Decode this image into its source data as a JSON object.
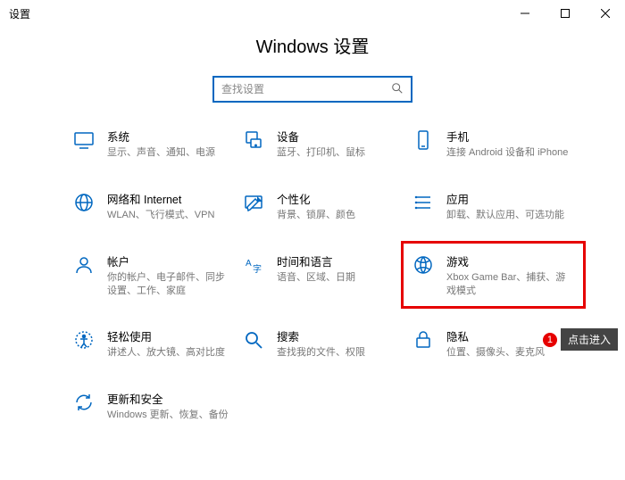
{
  "window": {
    "title": "设置"
  },
  "page_title": "Windows 设置",
  "search": {
    "placeholder": "查找设置"
  },
  "items": {
    "system": {
      "title": "系统",
      "desc": "显示、声音、通知、电源"
    },
    "devices": {
      "title": "设备",
      "desc": "蓝牙、打印机、鼠标"
    },
    "phone": {
      "title": "手机",
      "desc": "连接 Android 设备和 iPhone"
    },
    "network": {
      "title": "网络和 Internet",
      "desc": "WLAN、飞行模式、VPN"
    },
    "personalization": {
      "title": "个性化",
      "desc": "背景、锁屏、颜色"
    },
    "apps": {
      "title": "应用",
      "desc": "卸载、默认应用、可选功能"
    },
    "accounts": {
      "title": "帐户",
      "desc": "你的帐户、电子邮件、同步设置、工作、家庭"
    },
    "time": {
      "title": "时间和语言",
      "desc": "语音、区域、日期"
    },
    "gaming": {
      "title": "游戏",
      "desc": "Xbox Game Bar、捕获、游戏模式"
    },
    "ease": {
      "title": "轻松使用",
      "desc": "讲述人、放大镜、高对比度"
    },
    "search_cat": {
      "title": "搜索",
      "desc": "查找我的文件、权限"
    },
    "privacy": {
      "title": "隐私",
      "desc": "位置、摄像头、麦克风"
    },
    "update": {
      "title": "更新和安全",
      "desc": "Windows 更新、恢复、备份"
    }
  },
  "callout": {
    "num": "1",
    "text": "点击进入"
  }
}
